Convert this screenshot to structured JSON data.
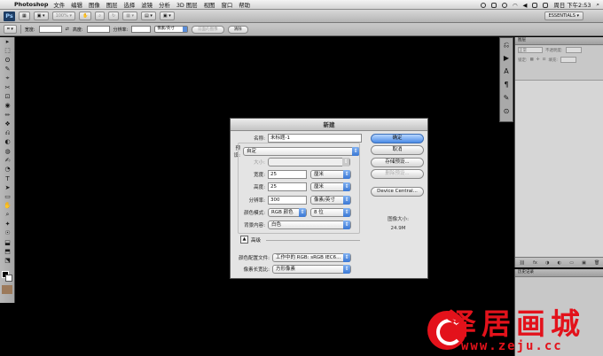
{
  "menubar": {
    "app_name": "Photoshop",
    "items": [
      "文件",
      "编辑",
      "图像",
      "图层",
      "选择",
      "滤镜",
      "分析",
      "3D 图层",
      "视图",
      "窗口",
      "帮助"
    ],
    "clock": "周日 下午2:53"
  },
  "appbar": {
    "logo": "Ps",
    "zoom": "100%",
    "workspace": "ESSENTIALS ▾"
  },
  "options": {
    "width_label": "宽度:",
    "height_label": "高度:",
    "resolution_label": "分辨率:",
    "unit_select": "像素/英寸",
    "front_image_button": "前面的图像",
    "clear_button": "清除"
  },
  "tools": {
    "icons": [
      "▸",
      "⬚",
      "ʘ",
      "✎",
      "⌖",
      "✂",
      "⊡",
      "◉",
      "✏",
      "❖",
      "⎌",
      "◐",
      "◍",
      "✍",
      "◔",
      "T",
      "➤",
      "▭",
      "✋",
      "⌕",
      "✦",
      "☉",
      "⬓",
      "⬒",
      "⬔"
    ]
  },
  "panel": {
    "tab": "图层",
    "blend_mode": "正常",
    "opacity_label": "不透明度:",
    "lock_label": "锁定:",
    "fill_label": "填充:",
    "footer_icons": [
      "⛓",
      "fx",
      "◑",
      "◐",
      "▭",
      "▣",
      "🗑"
    ],
    "bottom_tab": "历史记录"
  },
  "dialog": {
    "title": "新建",
    "name_label": "名称:",
    "name_value": "未标题-1",
    "preset_label": "预设:",
    "preset_value": "自定",
    "size_label": "大小:",
    "width_label": "宽度:",
    "width_value": "25",
    "width_unit": "厘米",
    "height_label": "高度:",
    "height_value": "25",
    "height_unit": "厘米",
    "resolution_label": "分辨率:",
    "resolution_value": "300",
    "resolution_unit": "像素/英寸",
    "color_mode_label": "颜色模式:",
    "color_mode_value": "RGB 颜色",
    "bit_depth_value": "8 位",
    "background_label": "背景内容:",
    "background_value": "白色",
    "advanced_label": "高级",
    "color_profile_label": "颜色配置文件:",
    "color_profile_value": "工作中的 RGB: sRGB IEC6...",
    "pixel_aspect_label": "像素长宽比:",
    "pixel_aspect_value": "方形像素",
    "ok_button": "确定",
    "cancel_button": "取消",
    "save_preset_button": "存储预设...",
    "delete_preset_button": "删除预设...",
    "device_central_button": "Device Central...",
    "image_size_label": "图像大小:",
    "image_size_value": "24.9M"
  },
  "watermark": {
    "text": "泽居画城",
    "url": "www.zeju.cc"
  }
}
